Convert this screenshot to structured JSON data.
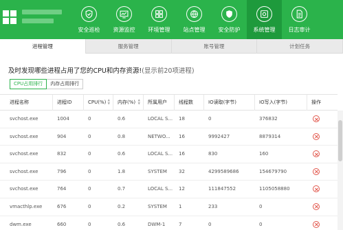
{
  "header": {
    "nav": [
      {
        "label": "安全巡检",
        "icon": "shield-check-icon"
      },
      {
        "label": "资源监控",
        "icon": "monitor-chart-icon"
      },
      {
        "label": "环境管理",
        "icon": "grid-icon"
      },
      {
        "label": "站点管理",
        "icon": "site-icon"
      },
      {
        "label": "安全防护",
        "icon": "shield-icon"
      },
      {
        "label": "系统管理",
        "icon": "settings-box-icon"
      },
      {
        "label": "日志审计",
        "icon": "document-icon"
      }
    ],
    "active_nav": "系统管理",
    "accent_color": "#2bb34b"
  },
  "tabs": [
    {
      "label": "进程管理",
      "active": true
    },
    {
      "label": "服务管理",
      "active": false
    },
    {
      "label": "账号管理",
      "active": false
    },
    {
      "label": "计划任务",
      "active": false
    }
  ],
  "page": {
    "title": "及时发现哪些进程占用了您的CPU和内存资源!",
    "subtitle": "(显示前20项进程)"
  },
  "sort_buttons": {
    "cpu": "CPU占用排行",
    "mem": "内存占用排行"
  },
  "table": {
    "headers": [
      "进程名称",
      "进程ID",
      "CPU(%)",
      "内存(%)",
      "所属用户",
      "线程数",
      "IO读取(字节)",
      "IO写入(字节)",
      "操作"
    ],
    "rows": [
      [
        "svchost.exe",
        "1004",
        "0",
        "0.6",
        "LOCAL S...",
        "18",
        "0",
        "376832"
      ],
      [
        "svchost.exe",
        "904",
        "0",
        "0.8",
        "NETWO...",
        "16",
        "9992427",
        "8879314"
      ],
      [
        "svchost.exe",
        "832",
        "0",
        "0.6",
        "LOCAL S...",
        "16",
        "830",
        "160"
      ],
      [
        "svchost.exe",
        "796",
        "0",
        "1.8",
        "SYSTEM",
        "32",
        "4299589686",
        "154679790"
      ],
      [
        "svchost.exe",
        "764",
        "0",
        "0.7",
        "LOCAL S...",
        "12",
        "111847552",
        "1105058880"
      ],
      [
        "vmacthlp.exe",
        "676",
        "0",
        "0.2",
        "SYSTEM",
        "1",
        "233",
        "0"
      ],
      [
        "dwm.exe",
        "660",
        "0",
        "0.6",
        "DWM-1",
        "7",
        "0",
        "0"
      ]
    ]
  }
}
